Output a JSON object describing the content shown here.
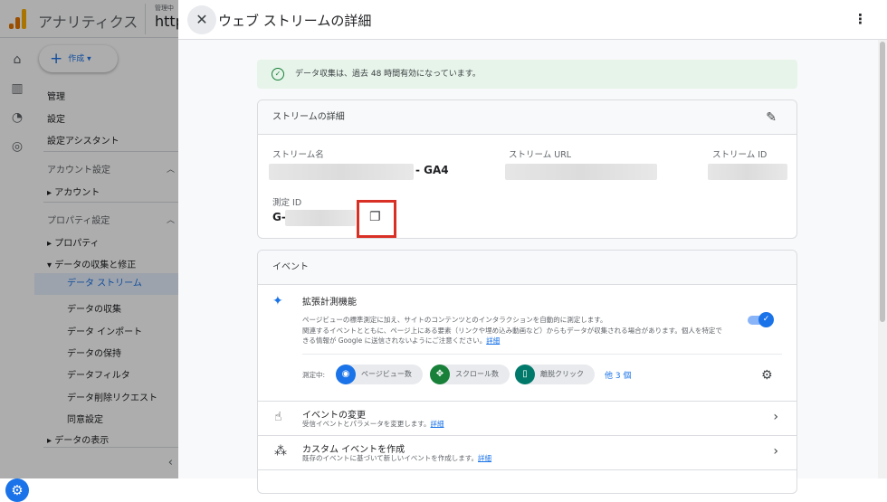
{
  "app": {
    "title": "アナリティクス",
    "account_label": "管理中",
    "account_value": "http"
  },
  "nav": {
    "create_label": "作成",
    "items": [
      "管理",
      "設定",
      "設定アシスタント"
    ],
    "account_section": "アカウント設定",
    "account_item": "アカウント",
    "property_section": "プロパティ設定",
    "property_item": "プロパティ",
    "data_group": "データの収集と修正",
    "data_items": [
      "データ ストリーム",
      "データの収集",
      "データ インポート",
      "データの保持",
      "データフィルタ",
      "データ削除リクエスト",
      "同意設定"
    ],
    "data_display": "データの表示"
  },
  "panel": {
    "title": "ウェブ ストリームの詳細",
    "banner": "データ収集は、過去 48 時間有効になっています。",
    "details": {
      "heading": "ストリームの詳細",
      "stream_name_label": "ストリーム名",
      "stream_name_suffix": "- GA4",
      "stream_url_label": "ストリーム URL",
      "stream_id_label": "ストリーム ID",
      "measurement_id_label": "測定 ID",
      "measurement_id_prefix": "G-"
    },
    "events": {
      "heading": "イベント",
      "enhanced": {
        "title": "拡張計測機能",
        "desc1": "ページビューの標準測定に加え、サイトのコンテンツとのインタラクションを自動的に測定します。",
        "desc2": "関連するイベントとともに、ページ上にある要素（リンクや埋め込み動画など）からもデータが収集される場合があります。個人を特定できる情報が Google に送信されないようにご注意ください。",
        "link": "詳細",
        "enabled": true,
        "measuring_label": "測定中:",
        "chips": [
          "ページビュー数",
          "スクロール数",
          "離脱クリック"
        ],
        "more": "他 3 個"
      },
      "rows": [
        {
          "title": "イベントの変更",
          "desc": "受信イベントとパラメータを変更します。",
          "link": "詳細"
        },
        {
          "title": "カスタム イベントを作成",
          "desc": "既存のイベントに基づいて新しいイベントを作成します。",
          "link": "詳細"
        }
      ]
    }
  },
  "colors": {
    "accent": "#1a73e8",
    "success_bg": "#e6f4ea",
    "highlight": "#d93025"
  }
}
